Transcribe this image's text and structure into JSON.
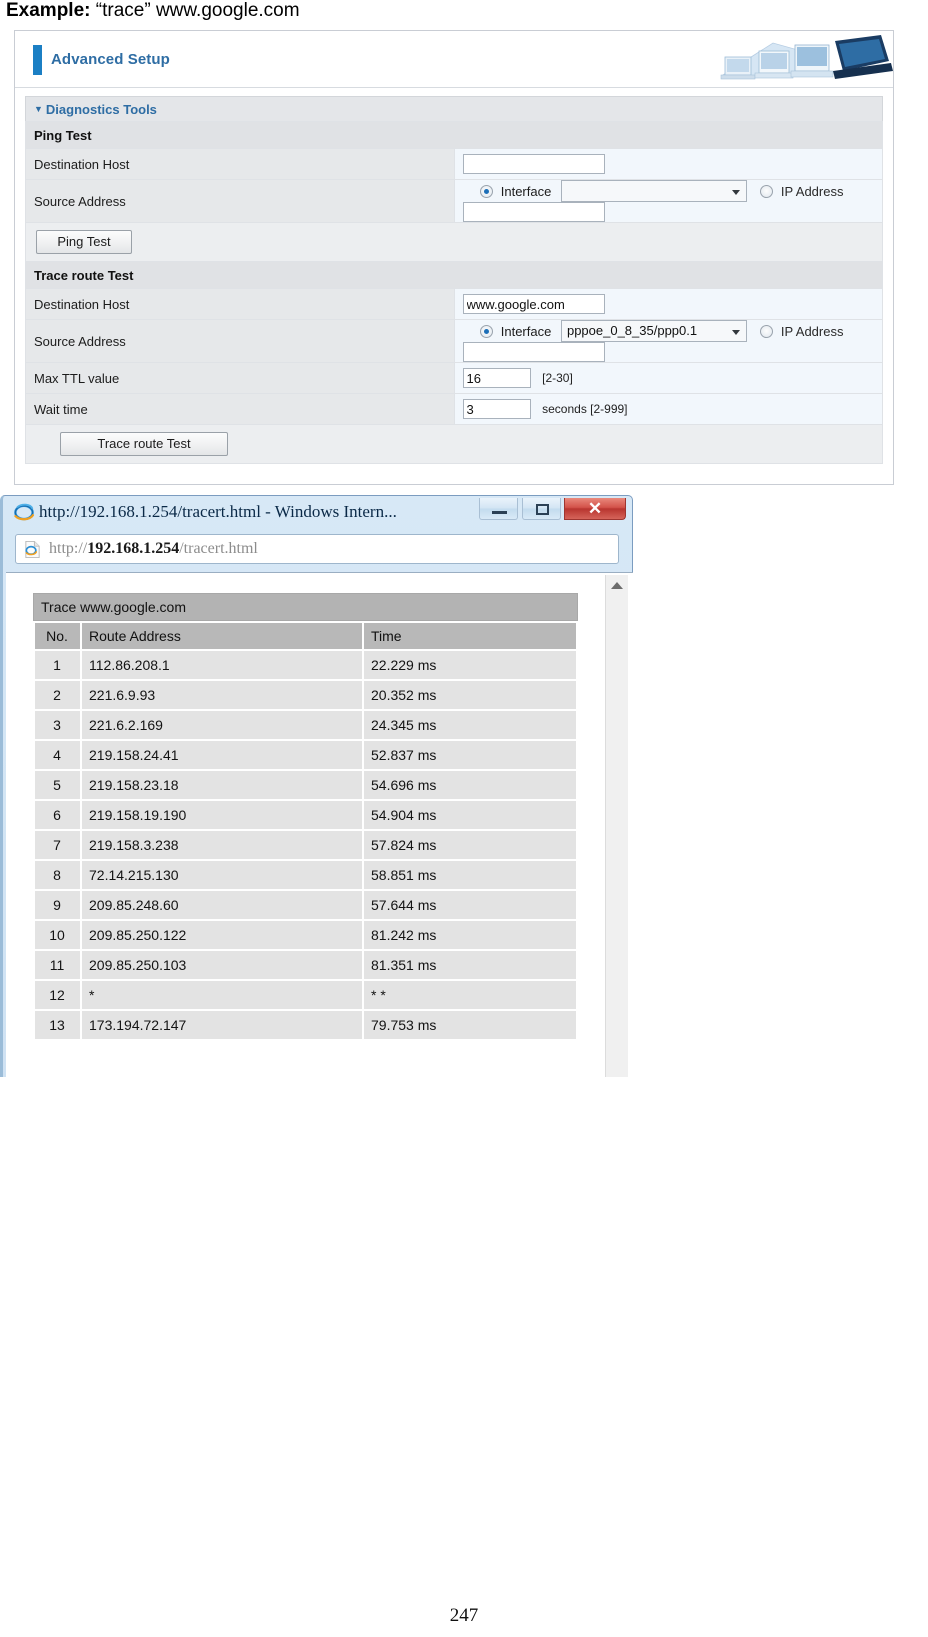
{
  "caption": {
    "prefix": "Example:",
    "rest": "“trace” www.google.com"
  },
  "router": {
    "header_title": "Advanced Setup",
    "tools_section": "Diagnostics Tools",
    "ping": {
      "section_label": "Ping Test",
      "destination_host_label": "Destination Host",
      "destination_host_value": "",
      "source_address_label": "Source Address",
      "interface_label": "Interface",
      "interface_value": "",
      "ip_address_label": "IP Address",
      "ip_address_value": "",
      "button_label": "Ping Test"
    },
    "trace": {
      "section_label": "Trace route Test",
      "destination_host_label": "Destination Host",
      "destination_host_value": "www.google.com",
      "source_address_label": "Source Address",
      "interface_label": "Interface",
      "interface_value": "pppoe_0_8_35/ppp0.1",
      "ip_address_label": "IP Address",
      "ip_address_value": "",
      "max_ttl_label": "Max TTL value",
      "max_ttl_value": "16",
      "max_ttl_hint": "[2-30]",
      "wait_time_label": "Wait time",
      "wait_time_value": "3",
      "wait_time_hint": "seconds [2-999]",
      "button_label": "Trace route Test"
    }
  },
  "browser": {
    "window_title": "http://192.168.1.254/tracert.html - Windows Intern...",
    "address_prefix": "http://",
    "address_host": "192.168.1.254",
    "address_path": "/tracert.html",
    "minimize_label": "",
    "restore_label": "",
    "close_label": "✕"
  },
  "results": {
    "caption": "Trace www.google.com",
    "columns": [
      "No.",
      "Route Address",
      "Time"
    ],
    "rows": [
      [
        "1",
        "112.86.208.1",
        "22.229 ms"
      ],
      [
        "2",
        "221.6.9.93",
        "20.352 ms"
      ],
      [
        "3",
        "221.6.2.169",
        "24.345 ms"
      ],
      [
        "4",
        "219.158.24.41",
        "52.837 ms"
      ],
      [
        "5",
        "219.158.23.18",
        "54.696 ms"
      ],
      [
        "6",
        "219.158.19.190",
        "54.904 ms"
      ],
      [
        "7",
        "219.158.3.238",
        "57.824 ms"
      ],
      [
        "8",
        "72.14.215.130",
        "58.851 ms"
      ],
      [
        "9",
        "209.85.248.60",
        "57.644 ms"
      ],
      [
        "10",
        "209.85.250.122",
        "81.242 ms"
      ],
      [
        "11",
        "209.85.250.103",
        "81.351 ms"
      ],
      [
        "12",
        "*",
        "* *"
      ],
      [
        "13",
        "173.194.72.147",
        "79.753 ms"
      ]
    ]
  },
  "page_number": "247",
  "colors": {
    "accent_blue": "#2e6da4",
    "header_bar": "#1b7fc4",
    "row_label_bg": "#e6e8ea",
    "row_value_bg": "#f2f7fc",
    "close_red": "#c4403a"
  }
}
